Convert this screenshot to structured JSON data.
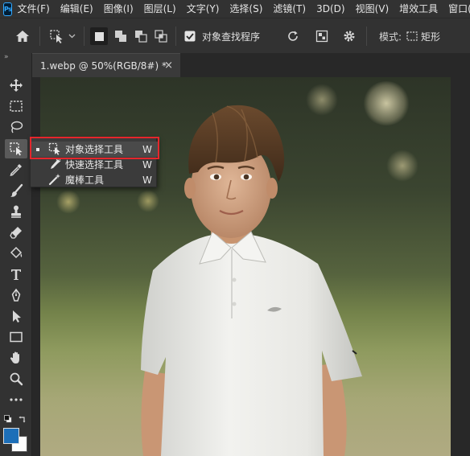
{
  "app": {
    "logo_text": "Ps"
  },
  "menu": [
    "文件(F)",
    "编辑(E)",
    "图像(I)",
    "图层(L)",
    "文字(Y)",
    "选择(S)",
    "滤镜(T)",
    "3D(D)",
    "视图(V)",
    "增效工具",
    "窗口(W)"
  ],
  "options_bar": {
    "object_finder_label": "对象查找程序",
    "object_finder_checked": true,
    "mode_label": "模式:",
    "mode_value": "矩形"
  },
  "document": {
    "tab_title": "1.webp @ 50%(RGB/8#) *",
    "close_glyph": "×"
  },
  "toolbar": {
    "collapse_glyph": "»"
  },
  "flyout": {
    "items": [
      {
        "label": "对象选择工具",
        "shortcut": "W",
        "selected": true
      },
      {
        "label": "快速选择工具",
        "shortcut": "W",
        "selected": false
      },
      {
        "label": "魔棒工具",
        "shortcut": "W",
        "selected": false
      }
    ]
  },
  "colors": {
    "foreground": "#1d6fb8",
    "background": "#ffffff",
    "highlight": "#e5262c",
    "accent": "#31a8ff"
  }
}
